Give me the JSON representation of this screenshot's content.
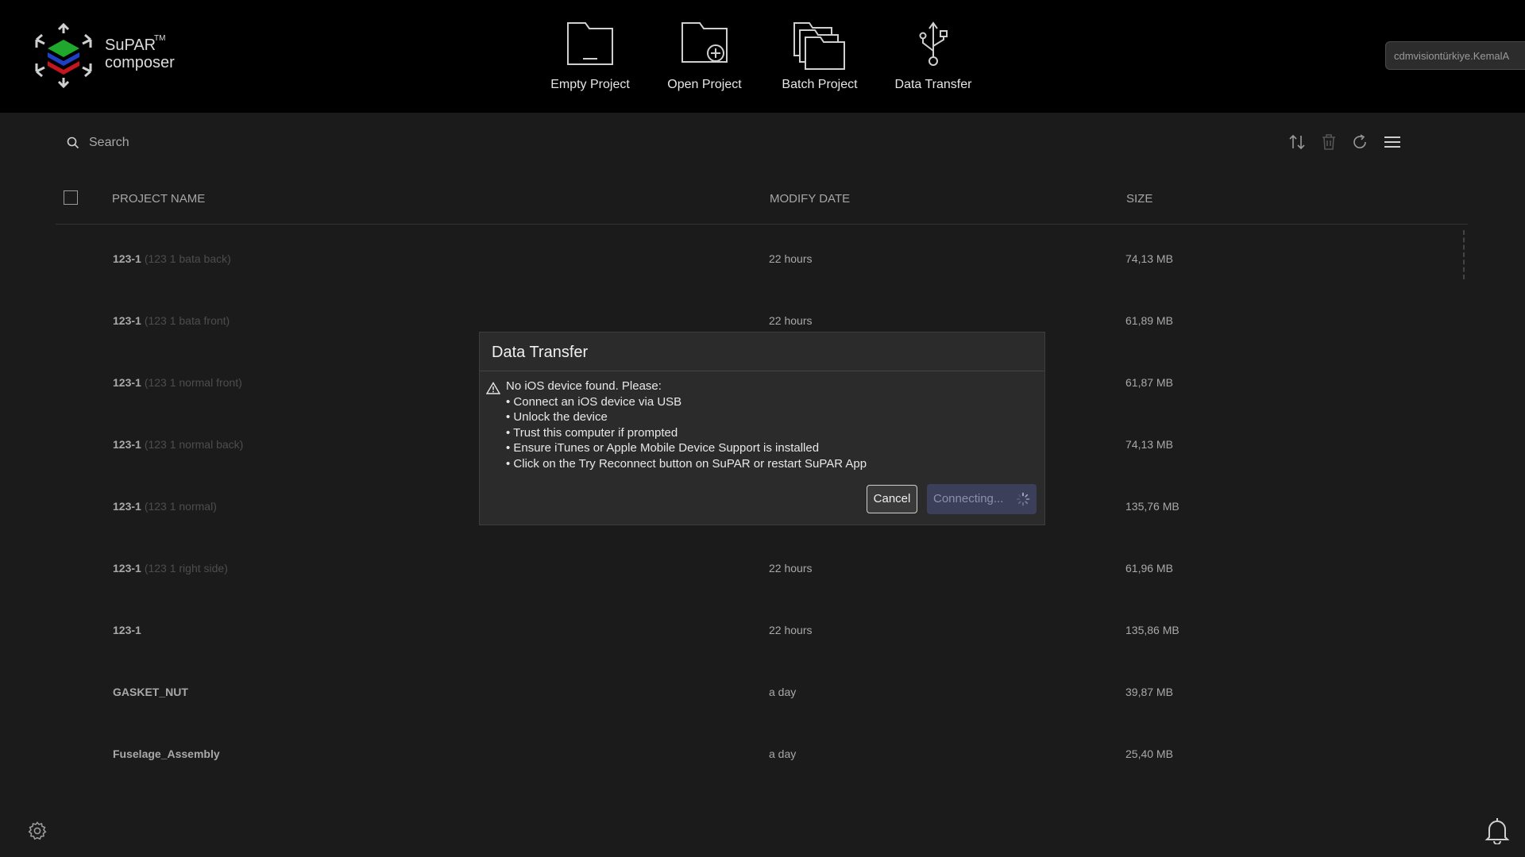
{
  "app": {
    "brand_name": "SuPAR",
    "brand_sub": "composer",
    "trademark": "TM"
  },
  "nav": {
    "empty_project": "Empty Project",
    "open_project": "Open Project",
    "batch_project": "Batch Project",
    "data_transfer": "Data Transfer"
  },
  "user": {
    "name": "cdmvisiontürkiye.KemalA"
  },
  "search": {
    "placeholder": "Search"
  },
  "table": {
    "headers": {
      "name": "PROJECT NAME",
      "date": "MODIFY DATE",
      "size": "SIZE"
    },
    "rows": [
      {
        "name": "123-1",
        "note": "(123 1 bata back)",
        "date": "22 hours",
        "size": "74,13 MB"
      },
      {
        "name": "123-1",
        "note": "(123 1 bata front)",
        "date": "22 hours",
        "size": "61,89 MB"
      },
      {
        "name": "123-1",
        "note": "(123 1 normal front)",
        "date": "",
        "size": "61,87 MB"
      },
      {
        "name": "123-1",
        "note": "(123 1 normal back)",
        "date": "",
        "size": "74,13 MB"
      },
      {
        "name": "123-1",
        "note": "(123 1 normal)",
        "date": "",
        "size": "135,76 MB"
      },
      {
        "name": "123-1",
        "note": "(123 1 right side)",
        "date": "22 hours",
        "size": "61,96 MB"
      },
      {
        "name": "123-1",
        "note": "",
        "date": "22 hours",
        "size": "135,86 MB"
      },
      {
        "name": "GASKET_NUT",
        "note": "",
        "date": "a day",
        "size": "39,87 MB"
      },
      {
        "name": "Fuselage_Assembly",
        "note": "",
        "date": "a day",
        "size": "25,40 MB"
      }
    ]
  },
  "dialog": {
    "title": "Data Transfer",
    "message": [
      "No iOS device found. Please:",
      "• Connect an iOS device via USB",
      "• Unlock the device",
      "• Trust this computer if prompted",
      "• Ensure iTunes or Apple Mobile Device Support is installed",
      "• Click on the Try Reconnect button on SuPAR or restart SuPAR App"
    ],
    "cancel_label": "Cancel",
    "connecting_label": "Connecting..."
  },
  "colors": {
    "background": "#1b1b1b",
    "topbar": "#000000",
    "dialog_bg": "#2b2b2b",
    "connect_button": "#3b3f5a",
    "logo_green": "#1fa82c",
    "logo_blue": "#1f3fc4",
    "logo_red": "#c4161c"
  },
  "icons": {
    "settings": "gear-icon",
    "notifications": "bell-icon",
    "sort": "sort-icon",
    "delete": "trash-icon",
    "refresh": "refresh-icon",
    "menu": "hamburger-icon",
    "warning": "warning-icon"
  }
}
